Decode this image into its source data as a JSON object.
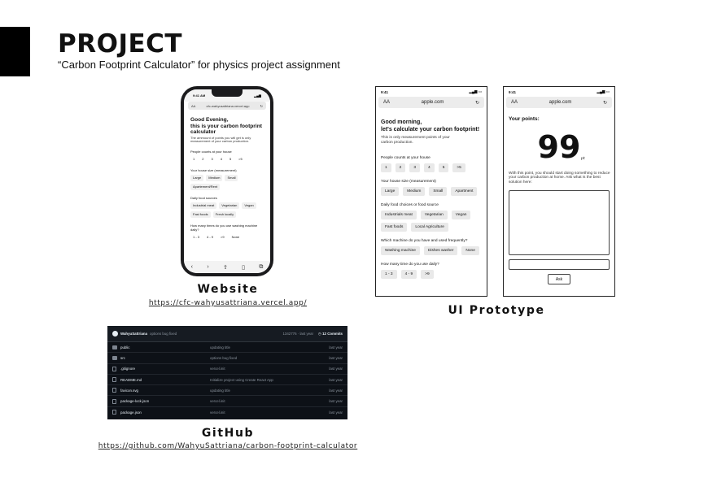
{
  "header": {
    "title": "PROJECT",
    "subtitle": "“Carbon Footprint Calculator” for physics project assignment"
  },
  "website": {
    "caption": "Website",
    "url": "https://cfc-wahyusattriana.vercel.app/",
    "phone": {
      "time": "9:41 AM",
      "address": "cfc-wahyusattriana.vercel.app",
      "address_prefix": "AA",
      "heading_line1": "Good Evening,",
      "heading_line2": "this is your carbon footprint calculator",
      "description": "The ammount of points you will get is only measurement of your carbon production.",
      "q1": "People counts at your house",
      "q1_options": [
        "1",
        "2",
        "3",
        "4",
        "5",
        ">5"
      ],
      "q2": "Your house size (measurement)",
      "q2_options": [
        "Large",
        "Medium",
        "Small",
        "Apartement/Rent"
      ],
      "q3": "Daily food sources",
      "q3_options": [
        "Industrial meat",
        "Vegetarian",
        "Vegan",
        "Fast foods",
        "Fresh locally"
      ],
      "q4": "How many times do you use washing machine daily?",
      "q4_options": [
        "1 - 3",
        "4 - 9",
        ">9",
        "None"
      ]
    }
  },
  "prototype": {
    "caption": "UI Prototype",
    "time": "9:41",
    "address_prefix": "AA",
    "address": "apple.com",
    "screen1": {
      "heading_line1": "Good morning,",
      "heading_line2": "let's calculate your carbon footprint!",
      "description": "This is only measurement points of your carbon production.",
      "q1": "People counts at your house",
      "q1_options": [
        "1",
        "2",
        "3",
        "4",
        "5",
        ">5"
      ],
      "q2": "Your house size (measurement)",
      "q2_options": [
        "Large",
        "Medium",
        "Small",
        "Apartment"
      ],
      "q3": "Daily food choices or food source",
      "q3_options": [
        "Industrials meat",
        "Vegetarian",
        "Vegan",
        "Fast foods",
        "Local Agriculture"
      ],
      "q4": "Which machine do you have and used frequently?",
      "q4_options": [
        "Washing machine",
        "Dishes washer",
        "None"
      ],
      "q5": "How many time do you use daily?",
      "q5_options": [
        "1 - 3",
        "4 - 9",
        ">9"
      ]
    },
    "screen2": {
      "label": "Your points:",
      "points": "99",
      "unit": "pt",
      "advice": "With this point, you should start doing something to reduce your carbon production at home. Ask what is the best solution here:",
      "ask_button": "Ask"
    }
  },
  "github": {
    "caption": "GitHub",
    "url": "https://github.com/WahyuSattriana/carbon-footprint-calculator",
    "user": "WahyuSattriana",
    "last_commit_message": "options bug fixed",
    "last_commit_meta": "1342776 · last year",
    "commits_label": "12 Commits",
    "files": [
      {
        "name": "public",
        "type": "dir",
        "commit": "updating title",
        "time": "last year"
      },
      {
        "name": "src",
        "type": "dir",
        "commit": "options bug fixed",
        "time": "last year"
      },
      {
        "name": ".gitignore",
        "type": "file",
        "commit": "vercel.init",
        "time": "last year"
      },
      {
        "name": "README.md",
        "type": "file",
        "commit": "Initialize project using Create React App",
        "time": "last year"
      },
      {
        "name": "favicon.svg",
        "type": "file",
        "commit": "updating title",
        "time": "last year"
      },
      {
        "name": "package-lock.json",
        "type": "file",
        "commit": "vercel.init",
        "time": "last year"
      },
      {
        "name": "package.json",
        "type": "file",
        "commit": "vercel.init",
        "time": "last year"
      }
    ]
  }
}
